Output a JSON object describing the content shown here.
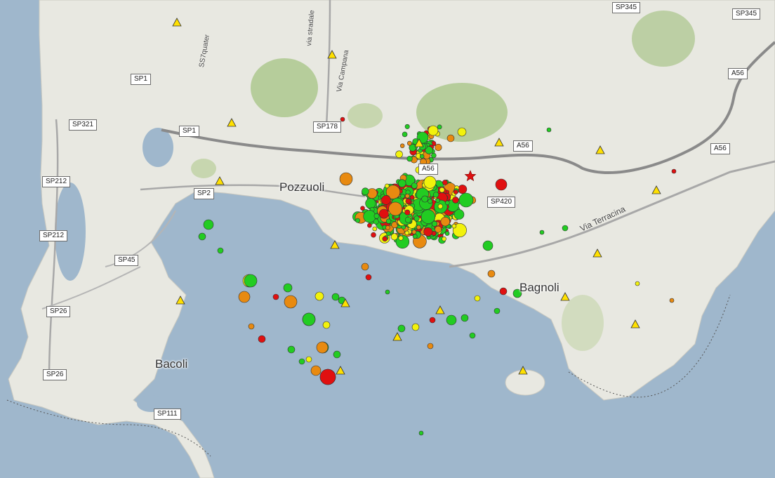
{
  "map": {
    "place_labels": [
      {
        "id": "pozzuoli",
        "text": "Pozzuoli"
      },
      {
        "id": "bagnoli",
        "text": "Bagnoli"
      },
      {
        "id": "bacoli",
        "text": "Bacoli"
      }
    ],
    "road_shields": [
      {
        "id": "sp345-a",
        "text": "SP345"
      },
      {
        "id": "sp345-b",
        "text": "SP345"
      },
      {
        "id": "sp1-a",
        "text": "SP1"
      },
      {
        "id": "sp1-b",
        "text": "SP1"
      },
      {
        "id": "sp321",
        "text": "SP321"
      },
      {
        "id": "sp178",
        "text": "SP178"
      },
      {
        "id": "a56-a",
        "text": "A56"
      },
      {
        "id": "a56-b",
        "text": "A56"
      },
      {
        "id": "a56-c",
        "text": "A56"
      },
      {
        "id": "a56-d",
        "text": "A56"
      },
      {
        "id": "sp2",
        "text": "SP2"
      },
      {
        "id": "sp212-a",
        "text": "SP212"
      },
      {
        "id": "sp212-b",
        "text": "SP212"
      },
      {
        "id": "sp420",
        "text": "SP420"
      },
      {
        "id": "sp45",
        "text": "SP45"
      },
      {
        "id": "sp26-a",
        "text": "SP26"
      },
      {
        "id": "sp26-b",
        "text": "SP26"
      },
      {
        "id": "sp111",
        "text": "SP111"
      }
    ],
    "street_labels": [
      {
        "id": "ss7quater",
        "text": "SS7quater"
      },
      {
        "id": "via-campana",
        "text": "Via Campana"
      },
      {
        "id": "via-stradale",
        "text": "via stradale"
      },
      {
        "id": "via-terracina",
        "text": "Via Terracina"
      }
    ],
    "colors": {
      "sea": "#9fb7cc",
      "land": "#e6e6df",
      "quake_green": "#22cc22",
      "quake_yellow": "#f2f20c",
      "quake_orange": "#e88a10",
      "quake_red": "#e01010",
      "station_fill": "#ffe000",
      "epicenter_star": "#e01010"
    },
    "legend_semantics": {
      "markers": "earthquake-epicenter circles colored by age class; size by magnitude",
      "triangles": "seismic stations",
      "star": "main event"
    }
  }
}
